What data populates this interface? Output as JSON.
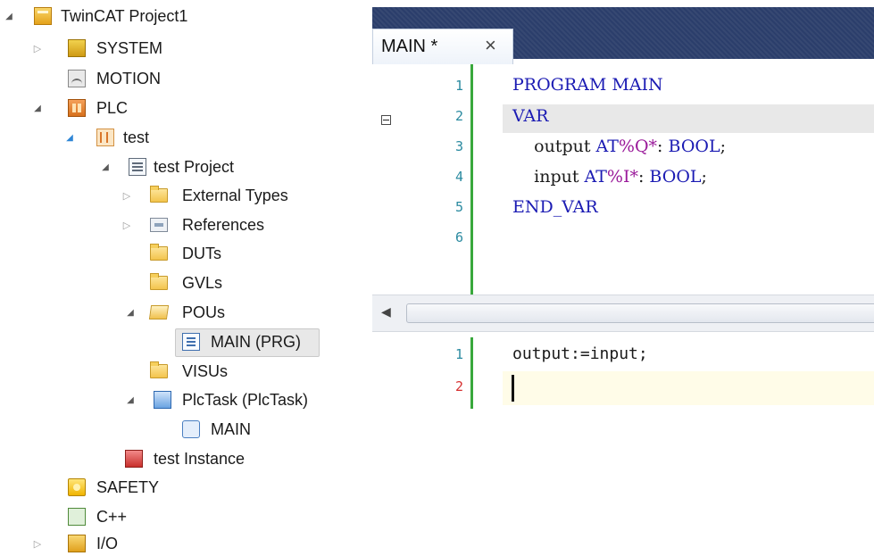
{
  "tree": {
    "items": [
      {
        "label": "TwinCAT Project1",
        "icon": "project-icon",
        "toggle": "expanded"
      },
      {
        "label": "SYSTEM",
        "icon": "system-icon",
        "toggle": "collapsed"
      },
      {
        "label": "MOTION",
        "icon": "motion-icon",
        "toggle": ""
      },
      {
        "label": "PLC",
        "icon": "plc-icon",
        "toggle": "expanded"
      },
      {
        "label": "test",
        "icon": "plc-project-icon",
        "toggle": "expanded"
      },
      {
        "label": "test Project",
        "icon": "project-file-icon",
        "toggle": "expanded"
      },
      {
        "label": "External Types",
        "icon": "folder-icon",
        "toggle": "collapsed"
      },
      {
        "label": "References",
        "icon": "references-icon",
        "toggle": "collapsed"
      },
      {
        "label": "DUTs",
        "icon": "folder-icon",
        "toggle": ""
      },
      {
        "label": "GVLs",
        "icon": "folder-icon",
        "toggle": ""
      },
      {
        "label": "POUs",
        "icon": "folder-open-icon",
        "toggle": "expanded"
      },
      {
        "label": "MAIN (PRG)",
        "icon": "program-icon",
        "toggle": "",
        "selected": true
      },
      {
        "label": "VISUs",
        "icon": "folder-icon",
        "toggle": ""
      },
      {
        "label": "PlcTask (PlcTask)",
        "icon": "task-icon",
        "toggle": "expanded"
      },
      {
        "label": "MAIN",
        "icon": "program-reference-icon",
        "toggle": ""
      },
      {
        "label": "test Instance",
        "icon": "instance-icon",
        "toggle": ""
      },
      {
        "label": "SAFETY",
        "icon": "safety-icon",
        "toggle": ""
      },
      {
        "label": "C++",
        "icon": "cpp-icon",
        "toggle": ""
      },
      {
        "label": "I/O",
        "icon": "io-icon",
        "toggle": "collapsed"
      }
    ]
  },
  "editor": {
    "tab_title": "MAIN *",
    "tab_close": "×",
    "declaration": {
      "line_numbers": [
        "1",
        "2",
        "3",
        "4",
        "5",
        "6"
      ],
      "lines": [
        "PROGRAM MAIN",
        "VAR",
        "    output AT%Q*: BOOL;",
        "    input AT%I*: BOOL;",
        "END_VAR",
        ""
      ]
    },
    "implementation": {
      "line_numbers": [
        "1",
        "2"
      ],
      "lines": [
        "output:=input;",
        ""
      ]
    },
    "scroll_left_arrow": "◀"
  }
}
